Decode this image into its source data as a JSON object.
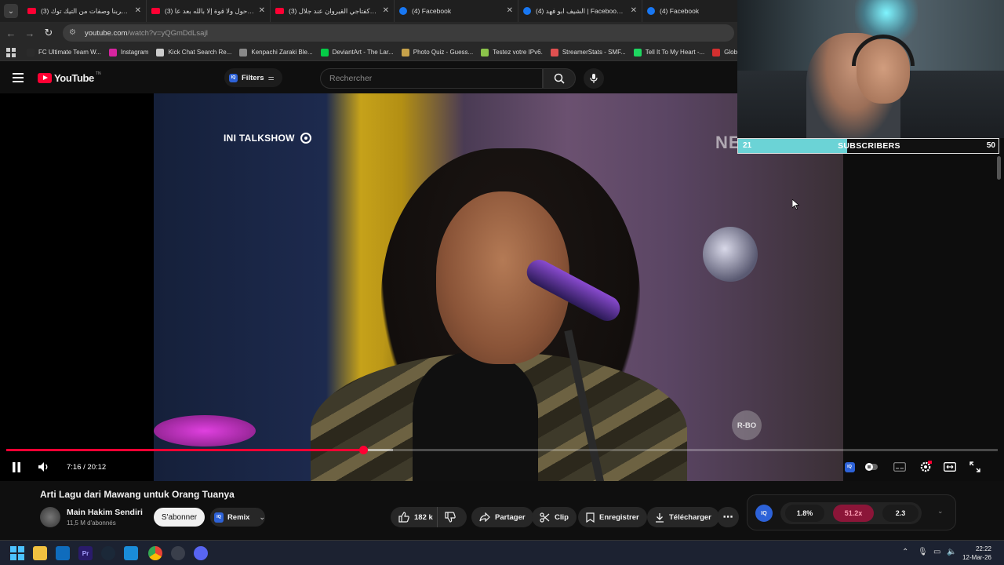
{
  "browser": {
    "tabs": [
      {
        "title": "(3) جربنا وصفات من التيك توك 🍓",
        "icon": "youtube-icon"
      },
      {
        "title": "(3) ولا حول ولا قوة إلا بالله بعد عا",
        "icon": "youtube-icon"
      },
      {
        "title": "(3) سر كفتاجي القيروان عند جلال",
        "icon": "youtube-icon"
      },
      {
        "title": "(4) Facebook",
        "icon": "facebook-icon"
      },
      {
        "title": "(4) الشيف ابو فهد | Facebook -ls",
        "icon": "facebook-icon"
      },
      {
        "title": "(4) Facebook",
        "icon": "facebook-icon"
      }
    ],
    "url_host": "youtube.com",
    "url_path": "/watch?v=yQGmDdLsajI",
    "bookmarks": [
      {
        "label": "FC Ultimate Team W...",
        "color": "#2b2b2b"
      },
      {
        "label": "Instagram",
        "color": "#d6249f"
      },
      {
        "label": "Kick Chat Search Re...",
        "color": "#cccccc"
      },
      {
        "label": "Kenpachi Zaraki Ble...",
        "color": "#888888"
      },
      {
        "label": "DeviantArt - The Lar...",
        "color": "#05cc47"
      },
      {
        "label": "Photo Quiz - Guess...",
        "color": "#c7a24a"
      },
      {
        "label": "Testez votre IPv6.",
        "color": "#8bc34a"
      },
      {
        "label": "StreamerStats - SMF...",
        "color": "#e05050"
      },
      {
        "label": "Tell It To My Heart -...",
        "color": "#1ed760"
      },
      {
        "label": "Globa",
        "color": "#d32f2f"
      }
    ]
  },
  "youtube": {
    "logo_text": "YouTube",
    "logo_sup": "TN",
    "filters_label": "Filters",
    "search_placeholder": "Rechercher"
  },
  "video": {
    "overlay_show": "INI TALKSHOW",
    "overlay_net": "NET",
    "overlay_watermark": "R-BO",
    "current_time": "7:16",
    "duration": "20:12",
    "time_text": "7:16 / 20:12",
    "progress_fraction": 0.36,
    "buffer_fraction": 0.39,
    "title": "Arti Lagu dari Mawang untuk Orang Tuanya",
    "channel": "Main Hakim Sendiri",
    "subscribers": "11,5 M d'abonnés",
    "subscribe_label": "S'abonner",
    "remix_label": "Remix",
    "likes": "182 k",
    "share_label": "Partager",
    "clip_label": "Clip",
    "save_label": "Enregistrer",
    "download_label": "Télécharger"
  },
  "stream_overlay": {
    "left_value": "21",
    "label": "SUBSCRIBERS",
    "right_value": "50",
    "fill_fraction": 0.42,
    "bar_color": "#6bd3d6"
  },
  "iq_widget": {
    "badge": "IQ",
    "value1": "1.8%",
    "value2": "51.2x",
    "value3": "2.3"
  },
  "taskbar": {
    "time": "22:22",
    "date": "12-Mar-26"
  },
  "colors": {
    "accent": "#ff0033",
    "iq_blue": "#2d62d8",
    "iq_pink": "#8b1538"
  }
}
